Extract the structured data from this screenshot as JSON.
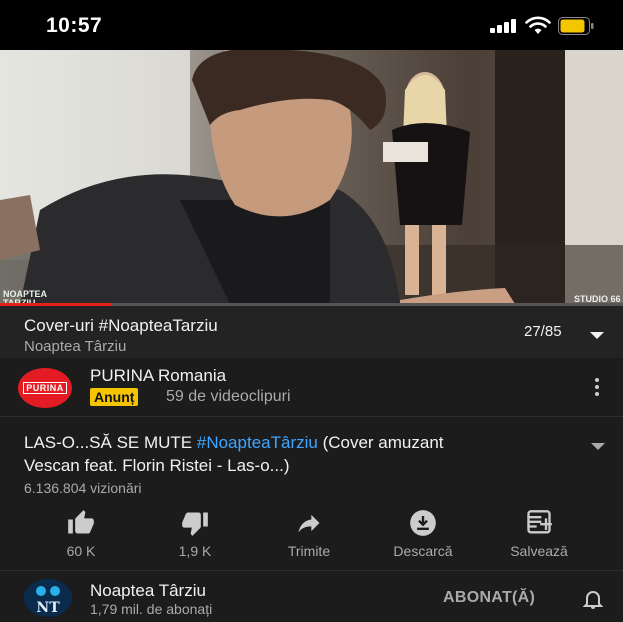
{
  "status_bar": {
    "time": "10:57"
  },
  "player": {
    "watermark_left": "NOAPTEA TARZIU",
    "watermark_right": "STUDIO 66",
    "progress_fraction": 0.18
  },
  "playlist": {
    "title": "Cover-uri #NoapteaTarziu",
    "channel": "Noaptea Târziu",
    "position": "27/85"
  },
  "ad": {
    "logo_text": "PURINA",
    "name": "PURINA Romania",
    "badge": "Anunț",
    "videos": "59 de videoclipuri"
  },
  "video": {
    "title_line1_prefix": "LAS-O...SĂ SE MUTE ",
    "title_hashtag": "#NoapteaTârziu",
    "title_line1_suffix": " (Cover amuzant",
    "title_line2": "Vescan feat. Florin Ristei - Las-o...)",
    "views": "6.136.804 vizionări"
  },
  "actions": [
    {
      "label": "60 K",
      "icon": "thumbs-up-icon"
    },
    {
      "label": "1,9 K",
      "icon": "thumbs-down-icon"
    },
    {
      "label": "Trimite",
      "icon": "share-icon"
    },
    {
      "label": "Descarcă",
      "icon": "download-icon"
    },
    {
      "label": "Salvează",
      "icon": "save-playlist-icon"
    }
  ],
  "channel": {
    "avatar_text": "NT",
    "name": "Noaptea Târziu",
    "subscribers": "1,79 mil. de abonați",
    "subscribed_label": "ABONAT(Ă)"
  },
  "colors": {
    "accent": "#e62117",
    "link": "#3ea6ff",
    "badge": "#f5c400"
  }
}
